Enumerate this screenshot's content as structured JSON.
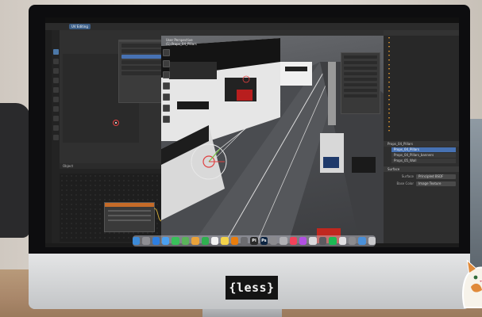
{
  "scene": {
    "description_note": ""
  },
  "monitor": {
    "badge_text": "{less}",
    "screen": {
      "workspace_active": "UV Editing",
      "uv_panel": {
        "title": ""
      },
      "node_editor": {
        "object_label": "Object"
      },
      "viewport": {
        "view_label_line1": "User Perspective",
        "view_label_line2": "(1) Props_04_Pillars"
      },
      "properties": {
        "material_name": "Props_04_Pillars",
        "slots": [
          "Props_04_Pillars",
          "Props_04_Pillars_banners",
          "Props_05_Wall"
        ],
        "selected_slot": 0,
        "surface_section": "Surface",
        "fields": [
          {
            "label": "Surface",
            "value": "Principled BSDF"
          },
          {
            "label": "Base Color",
            "value": "Image Texture"
          }
        ]
      }
    },
    "dock": {
      "icons": [
        {
          "name": "finder-icon",
          "color": "#3c8ad8",
          "glyph": ""
        },
        {
          "name": "launchpad-icon",
          "color": "#8e8e93",
          "glyph": ""
        },
        {
          "name": "safari-icon",
          "color": "#2d7ee0",
          "glyph": ""
        },
        {
          "name": "mail-icon",
          "color": "#4aa0f0",
          "glyph": ""
        },
        {
          "name": "messages-icon",
          "color": "#39c05a",
          "glyph": ""
        },
        {
          "name": "maps-icon",
          "color": "#5ab35a",
          "glyph": ""
        },
        {
          "name": "photos-icon",
          "color": "#e8a23a",
          "glyph": ""
        },
        {
          "name": "facetime-icon",
          "color": "#2fb04f",
          "glyph": ""
        },
        {
          "name": "calendar-icon",
          "color": "#f2f2f2",
          "glyph": ""
        },
        {
          "name": "notes-icon",
          "color": "#f4d34a",
          "glyph": ""
        },
        {
          "name": "blender-icon",
          "color": "#e87d0d",
          "glyph": ""
        },
        {
          "name": "finder-alt-icon",
          "color": "#6c6c70",
          "glyph": ""
        },
        {
          "name": "pixelmator-icon",
          "color": "#2a2a2a",
          "glyph": "Pi"
        },
        {
          "name": "photoshop-icon",
          "color": "#0b2340",
          "glyph": "Ps"
        },
        {
          "name": "app-icon-1",
          "color": "#8a8a8e",
          "glyph": ""
        },
        {
          "name": "app-icon-2",
          "color": "#b0b0b4",
          "glyph": ""
        },
        {
          "name": "music-icon",
          "color": "#f2425a",
          "glyph": ""
        },
        {
          "name": "podcasts-icon",
          "color": "#b150e2",
          "glyph": ""
        },
        {
          "name": "app-icon-3",
          "color": "#d9d9dc",
          "glyph": ""
        },
        {
          "name": "app-icon-4",
          "color": "#5b5b60",
          "glyph": ""
        },
        {
          "name": "spotify-icon",
          "color": "#1db954",
          "glyph": ""
        },
        {
          "name": "app-icon-5",
          "color": "#e0e0e3",
          "glyph": ""
        },
        {
          "name": "app-icon-6",
          "color": "#8a8a8e",
          "glyph": ""
        },
        {
          "name": "app-icon-7",
          "color": "#4a90d9",
          "glyph": ""
        },
        {
          "name": "trash-icon",
          "color": "#c9c9cc",
          "glyph": ""
        }
      ]
    }
  }
}
